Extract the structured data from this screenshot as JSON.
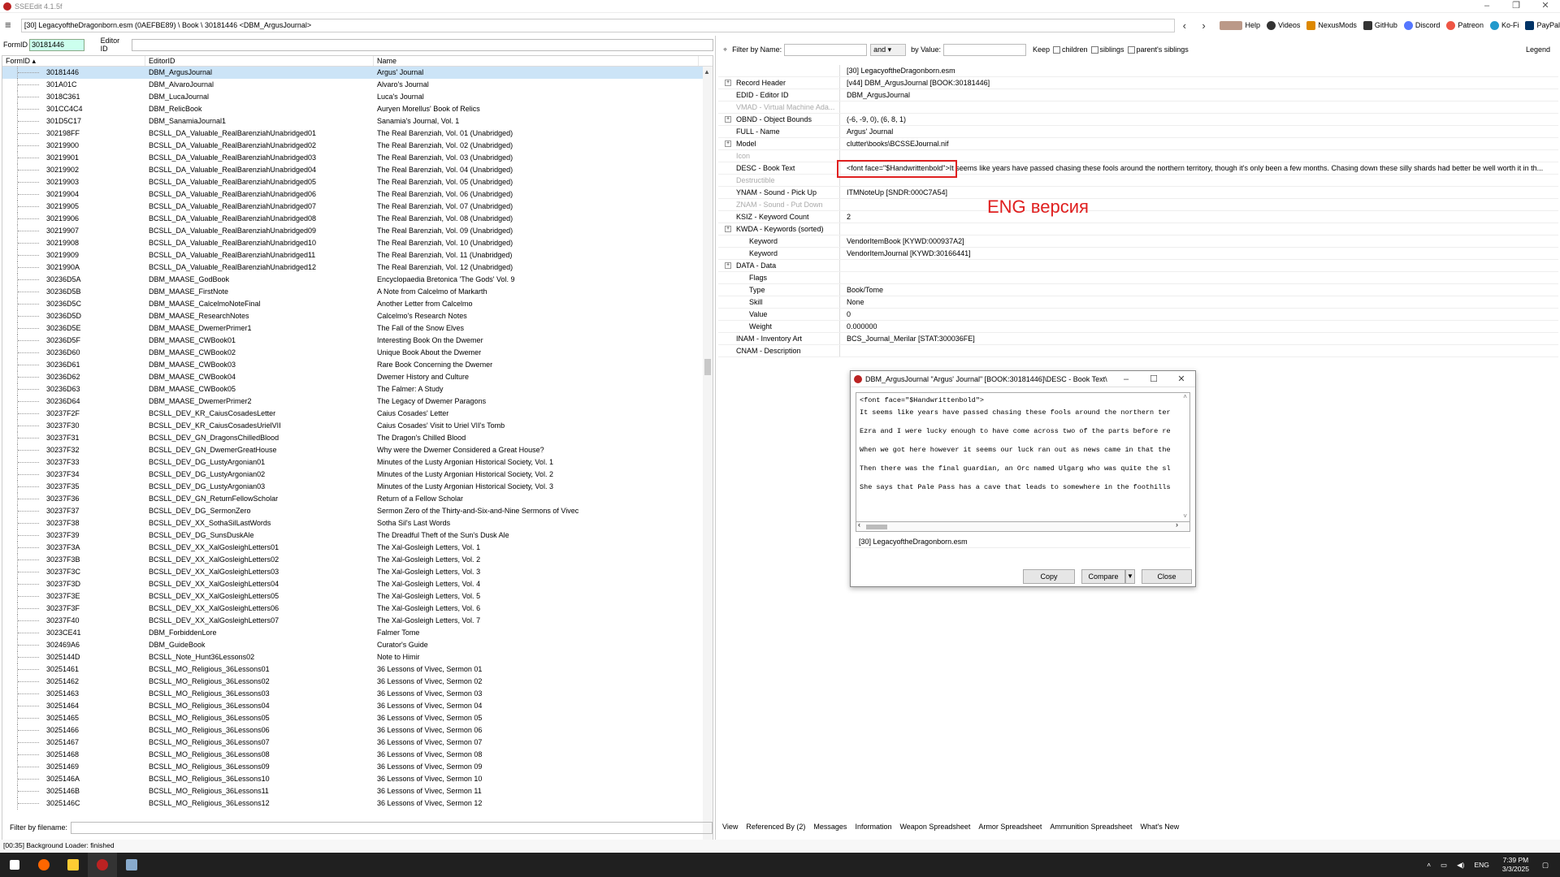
{
  "window": {
    "title": "SSEEdit 4.1.5f"
  },
  "toolbar": {
    "path": "[30] LegacyoftheDragonborn.esm (0AEFBE89) \\ Book \\ 30181446 <DBM_ArgusJournal>",
    "links": [
      "Help",
      "Videos",
      "NexusMods",
      "GitHub",
      "Discord",
      "Patreon",
      "Ko-Fi",
      "PayPal"
    ]
  },
  "left": {
    "formid_label": "FormID",
    "formid_value": "30181446",
    "editorid_label": "Editor ID",
    "columns": [
      "FormID",
      "EditorID",
      "Name"
    ],
    "rows": [
      [
        "30181446",
        "DBM_ArgusJournal",
        "Argus' Journal"
      ],
      [
        "301A01C",
        "DBM_AlvaroJournal",
        "Alvaro's Journal"
      ],
      [
        "3018C361",
        "DBM_LucaJournal",
        "Luca's Journal"
      ],
      [
        "301CC4C4",
        "DBM_RelicBook",
        "Auryen Morellus' Book of Relics"
      ],
      [
        "301D5C17",
        "DBM_SanamiaJournal1",
        "Sanamia's Journal, Vol. 1"
      ],
      [
        "302198FF",
        "BCSLL_DA_Valuable_RealBarenziahUnabridged01",
        "The Real Barenziah, Vol. 01 (Unabridged)"
      ],
      [
        "30219900",
        "BCSLL_DA_Valuable_RealBarenziahUnabridged02",
        "The Real Barenziah, Vol. 02 (Unabridged)"
      ],
      [
        "30219901",
        "BCSLL_DA_Valuable_RealBarenziahUnabridged03",
        "The Real Barenziah, Vol. 03 (Unabridged)"
      ],
      [
        "30219902",
        "BCSLL_DA_Valuable_RealBarenziahUnabridged04",
        "The Real Barenziah, Vol. 04 (Unabridged)"
      ],
      [
        "30219903",
        "BCSLL_DA_Valuable_RealBarenziahUnabridged05",
        "The Real Barenziah, Vol. 05 (Unabridged)"
      ],
      [
        "30219904",
        "BCSLL_DA_Valuable_RealBarenziahUnabridged06",
        "The Real Barenziah, Vol. 06 (Unabridged)"
      ],
      [
        "30219905",
        "BCSLL_DA_Valuable_RealBarenziahUnabridged07",
        "The Real Barenziah, Vol. 07 (Unabridged)"
      ],
      [
        "30219906",
        "BCSLL_DA_Valuable_RealBarenziahUnabridged08",
        "The Real Barenziah, Vol. 08 (Unabridged)"
      ],
      [
        "30219907",
        "BCSLL_DA_Valuable_RealBarenziahUnabridged09",
        "The Real Barenziah, Vol. 09 (Unabridged)"
      ],
      [
        "30219908",
        "BCSLL_DA_Valuable_RealBarenziahUnabridged10",
        "The Real Barenziah, Vol. 10 (Unabridged)"
      ],
      [
        "30219909",
        "BCSLL_DA_Valuable_RealBarenziahUnabridged11",
        "The Real Barenziah, Vol. 11 (Unabridged)"
      ],
      [
        "3021990A",
        "BCSLL_DA_Valuable_RealBarenziahUnabridged12",
        "The Real Barenziah, Vol. 12 (Unabridged)"
      ],
      [
        "30236D5A",
        "DBM_MAASE_GodBook",
        "Encyclopaedia Bretonica 'The Gods' Vol. 9"
      ],
      [
        "30236D5B",
        "DBM_MAASE_FirstNote",
        "A Note from Calcelmo of Markarth"
      ],
      [
        "30236D5C",
        "DBM_MAASE_CalcelmoNoteFinal",
        "Another Letter from Calcelmo"
      ],
      [
        "30236D5D",
        "DBM_MAASE_ResearchNotes",
        "Calcelmo's Research Notes"
      ],
      [
        "30236D5E",
        "DBM_MAASE_DwemerPrimer1",
        "The Fall of the Snow Elves"
      ],
      [
        "30236D5F",
        "DBM_MAASE_CWBook01",
        "Interesting Book On the Dwemer"
      ],
      [
        "30236D60",
        "DBM_MAASE_CWBook02",
        "Unique Book About the Dwemer"
      ],
      [
        "30236D61",
        "DBM_MAASE_CWBook03",
        "Rare Book Concerning the Dwemer"
      ],
      [
        "30236D62",
        "DBM_MAASE_CWBook04",
        "Dwemer History and Culture"
      ],
      [
        "30236D63",
        "DBM_MAASE_CWBook05",
        "The Falmer: A Study"
      ],
      [
        "30236D64",
        "DBM_MAASE_DwemerPrimer2",
        "The Legacy of Dwemer Paragons"
      ],
      [
        "30237F2F",
        "BCSLL_DEV_KR_CaiusCosadesLetter",
        "Caius Cosades' Letter"
      ],
      [
        "30237F30",
        "BCSLL_DEV_KR_CaiusCosadesUrielVII",
        "Caius Cosades' Visit to Uriel VII's Tomb"
      ],
      [
        "30237F31",
        "BCSLL_DEV_GN_DragonsChilledBlood",
        "The Dragon's Chilled Blood"
      ],
      [
        "30237F32",
        "BCSLL_DEV_GN_DwemerGreatHouse",
        "Why were the Dwemer Considered a Great House?"
      ],
      [
        "30237F33",
        "BCSLL_DEV_DG_LustyArgonian01",
        "Minutes of the Lusty Argonian Historical Society, Vol. 1"
      ],
      [
        "30237F34",
        "BCSLL_DEV_DG_LustyArgonian02",
        "Minutes of the Lusty Argonian Historical Society, Vol. 2"
      ],
      [
        "30237F35",
        "BCSLL_DEV_DG_LustyArgonian03",
        "Minutes of the Lusty Argonian Historical Society, Vol. 3"
      ],
      [
        "30237F36",
        "BCSLL_DEV_GN_ReturnFellowScholar",
        "Return of a Fellow Scholar"
      ],
      [
        "30237F37",
        "BCSLL_DEV_DG_SermonZero",
        "Sermon Zero of the Thirty-and-Six-and-Nine Sermons of Vivec"
      ],
      [
        "30237F38",
        "BCSLL_DEV_XX_SothaSilLastWords",
        "Sotha Sil's Last Words"
      ],
      [
        "30237F39",
        "BCSLL_DEV_DG_SunsDuskAle",
        "The Dreadful Theft of the Sun's Dusk Ale"
      ],
      [
        "30237F3A",
        "BCSLL_DEV_XX_XalGosleighLetters01",
        "The Xal-Gosleigh Letters, Vol. 1"
      ],
      [
        "30237F3B",
        "BCSLL_DEV_XX_XalGosleighLetters02",
        "The Xal-Gosleigh Letters, Vol. 2"
      ],
      [
        "30237F3C",
        "BCSLL_DEV_XX_XalGosleighLetters03",
        "The Xal-Gosleigh Letters, Vol. 3"
      ],
      [
        "30237F3D",
        "BCSLL_DEV_XX_XalGosleighLetters04",
        "The Xal-Gosleigh Letters, Vol. 4"
      ],
      [
        "30237F3E",
        "BCSLL_DEV_XX_XalGosleighLetters05",
        "The Xal-Gosleigh Letters, Vol. 5"
      ],
      [
        "30237F3F",
        "BCSLL_DEV_XX_XalGosleighLetters06",
        "The Xal-Gosleigh Letters, Vol. 6"
      ],
      [
        "30237F40",
        "BCSLL_DEV_XX_XalGosleighLetters07",
        "The Xal-Gosleigh Letters, Vol. 7"
      ],
      [
        "3023CE41",
        "DBM_ForbiddenLore",
        "Falmer Tome"
      ],
      [
        "302469A6",
        "DBM_GuideBook",
        "Curator's Guide"
      ],
      [
        "3025144D",
        "BCSLL_Note_Hunt36Lessons02",
        "Note to Himir"
      ],
      [
        "30251461",
        "BCSLL_MO_Religious_36Lessons01",
        "36 Lessons of Vivec, Sermon 01"
      ],
      [
        "30251462",
        "BCSLL_MO_Religious_36Lessons02",
        "36 Lessons of Vivec, Sermon 02"
      ],
      [
        "30251463",
        "BCSLL_MO_Religious_36Lessons03",
        "36 Lessons of Vivec, Sermon 03"
      ],
      [
        "30251464",
        "BCSLL_MO_Religious_36Lessons04",
        "36 Lessons of Vivec, Sermon 04"
      ],
      [
        "30251465",
        "BCSLL_MO_Religious_36Lessons05",
        "36 Lessons of Vivec, Sermon 05"
      ],
      [
        "30251466",
        "BCSLL_MO_Religious_36Lessons06",
        "36 Lessons of Vivec, Sermon 06"
      ],
      [
        "30251467",
        "BCSLL_MO_Religious_36Lessons07",
        "36 Lessons of Vivec, Sermon 07"
      ],
      [
        "30251468",
        "BCSLL_MO_Religious_36Lessons08",
        "36 Lessons of Vivec, Sermon 08"
      ],
      [
        "30251469",
        "BCSLL_MO_Religious_36Lessons09",
        "36 Lessons of Vivec, Sermon 09"
      ],
      [
        "3025146A",
        "BCSLL_MO_Religious_36Lessons10",
        "36 Lessons of Vivec, Sermon 10"
      ],
      [
        "3025146B",
        "BCSLL_MO_Religious_36Lessons11",
        "36 Lessons of Vivec, Sermon 11"
      ],
      [
        "3025146C",
        "BCSLL_MO_Religious_36Lessons12",
        "36 Lessons of Vivec, Sermon 12"
      ]
    ],
    "filter_label": "Filter by filename:"
  },
  "right": {
    "filter": {
      "by_name": "Filter by Name:",
      "and": "and",
      "by_value": "by Value:",
      "keep": "Keep",
      "children": "children",
      "siblings": "siblings",
      "parents": "parent's siblings",
      "legend": "Legend"
    },
    "file_header": "[30] LegacyoftheDragonborn.esm",
    "records": [
      {
        "k": "Record Header",
        "v": "[v44] DBM_ArgusJournal [BOOK:30181446]",
        "plus": true
      },
      {
        "k": "EDID - Editor ID",
        "v": "DBM_ArgusJournal"
      },
      {
        "k": "VMAD - Virtual Machine Ada...",
        "v": "",
        "dim": true
      },
      {
        "k": "OBND - Object Bounds",
        "v": "(-6, -9, 0), (6, 8, 1)",
        "plus": true
      },
      {
        "k": "FULL - Name",
        "v": "Argus' Journal"
      },
      {
        "k": "Model",
        "v": "clutter\\books\\BCSSEJournal.nif",
        "plus": true
      },
      {
        "k": "Icon",
        "v": "",
        "dim": true
      },
      {
        "k": "DESC - Book Text",
        "v": "<font face=\"$Handwrittenbold\">It seems like years have passed chasing these fools around the northern territory, though it's only been a few months. Chasing down these silly shards had better be well worth it in th..."
      },
      {
        "k": "Destructible",
        "v": "",
        "dim": true
      },
      {
        "k": "YNAM - Sound - Pick Up",
        "v": "ITMNoteUp [SNDR:000C7A54]"
      },
      {
        "k": "ZNAM - Sound - Put Down",
        "v": "",
        "dim": true
      },
      {
        "k": "KSIZ - Keyword Count",
        "v": "2"
      },
      {
        "k": "KWDA - Keywords (sorted)",
        "v": "",
        "plus": true
      },
      {
        "k": "Keyword",
        "v": "VendorItemBook [KYWD:000937A2]",
        "sub": true
      },
      {
        "k": "Keyword",
        "v": "VendorItemJournal [KYWD:30166441]",
        "sub": true
      },
      {
        "k": "DATA - Data",
        "v": "",
        "plus": true
      },
      {
        "k": "Flags",
        "v": "",
        "sub": true
      },
      {
        "k": "Type",
        "v": "Book/Tome",
        "sub": true
      },
      {
        "k": "Skill",
        "v": "None",
        "sub": true
      },
      {
        "k": "Value",
        "v": "0",
        "sub": true
      },
      {
        "k": "Weight",
        "v": "0.000000",
        "sub": true
      },
      {
        "k": "INAM - Inventory Art",
        "v": "BCS_Journal_Merilar [STAT:300036FE]"
      },
      {
        "k": "CNAM - Description",
        "v": ""
      }
    ],
    "annotation": "ENG версия",
    "tabs": [
      "View",
      "Referenced By (2)",
      "Messages",
      "Information",
      "Weapon Spreadsheet",
      "Armor Spreadsheet",
      "Ammunition Spreadsheet",
      "What's New"
    ]
  },
  "dialog": {
    "title": "DBM_ArgusJournal \"Argus' Journal\" [BOOK:30181446]\\DESC - Book Text\\",
    "lines": [
      "<font face=\"$Handwrittenbold\">",
      "It seems like years have passed chasing these fools around the northern ter",
      "Ezra and I were lucky enough to have come across two of the parts before re",
      "When we got here however it seems our luck ran out as news came in that the",
      "Then there was the final guardian, an Orc named Ulgarg who was quite the sl",
      "She says that Pale Pass has a cave that leads to somewhere in the foothills"
    ],
    "source": "[30] LegacyoftheDragonborn.esm",
    "copy": "Copy",
    "compare": "Compare",
    "close": "Close"
  },
  "status": "[00:35] Background Loader: finished",
  "tray": {
    "lang": "ENG",
    "time": "7:39 PM",
    "date": "3/3/2025"
  }
}
